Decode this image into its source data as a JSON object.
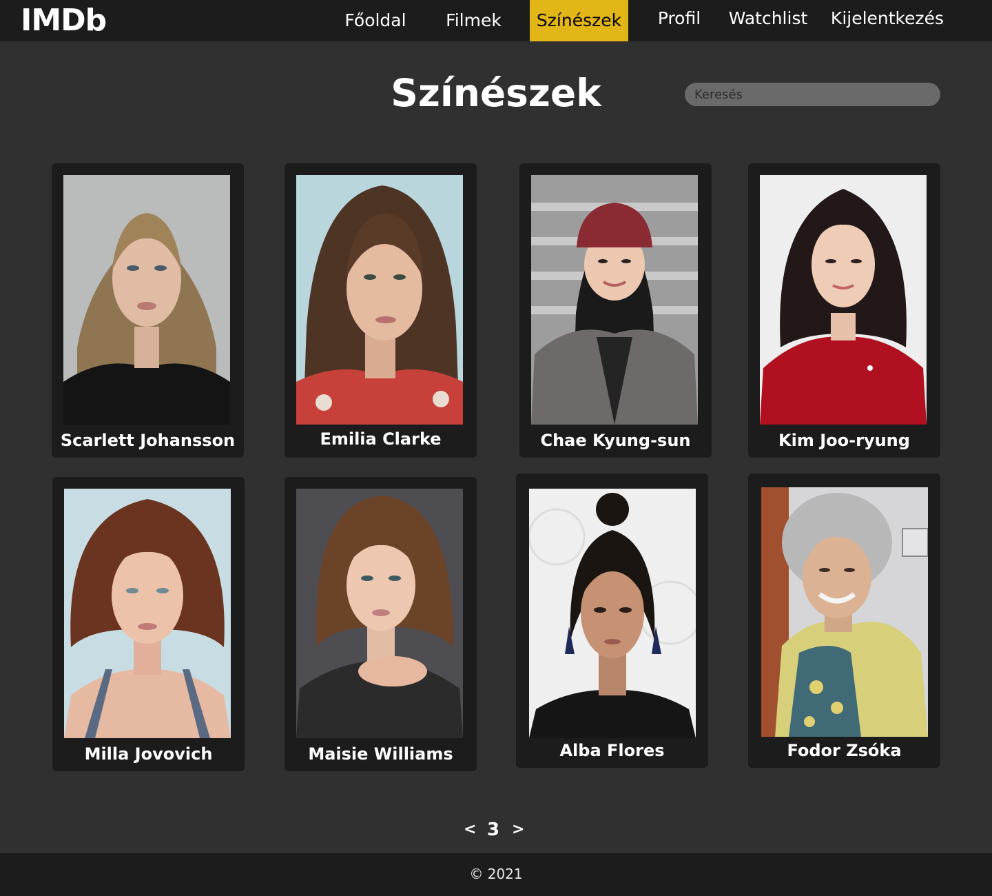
{
  "header": {
    "logo": "IMDb",
    "nav": [
      {
        "label": "Főoldal"
      },
      {
        "label": "Filmek"
      },
      {
        "label": "Színészek",
        "active": true
      },
      {
        "label": "Profil"
      },
      {
        "label": "Watchlist"
      },
      {
        "label": "Kijelentkezés"
      }
    ]
  },
  "main": {
    "title": "Színészek",
    "search": {
      "placeholder": "Keresés",
      "value": ""
    },
    "actors": [
      {
        "name": "Scarlett Johansson"
      },
      {
        "name": "Emilia Clarke"
      },
      {
        "name": "Chae Kyung-sun"
      },
      {
        "name": "Kim Joo-ryung"
      },
      {
        "name": "Milla Jovovich"
      },
      {
        "name": "Maisie Williams"
      },
      {
        "name": "Alba Flores"
      },
      {
        "name": "Fodor Zsóka"
      }
    ]
  },
  "pagination": {
    "prev": "<",
    "current": "3",
    "next": ">"
  },
  "footer": {
    "text": "© 2021"
  },
  "colors": {
    "accent": "#e2b616",
    "background": "#303030",
    "panel": "#1c1c1c"
  }
}
